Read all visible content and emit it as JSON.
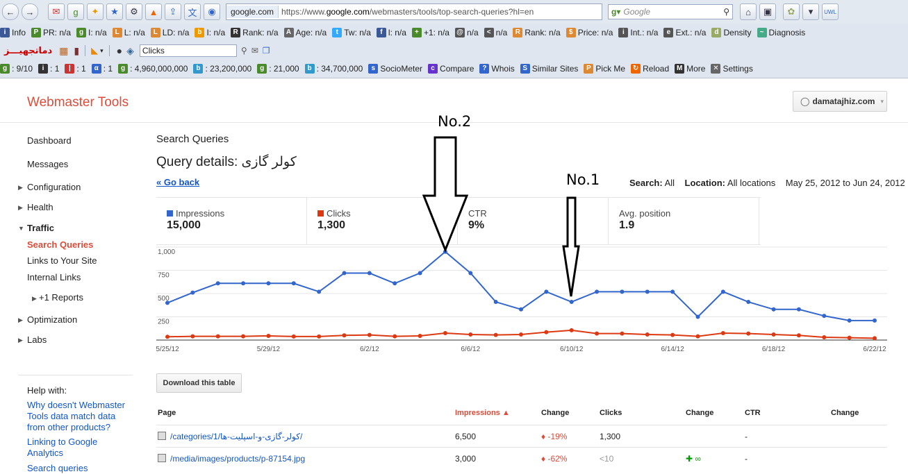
{
  "browser": {
    "url_host": "google.com",
    "url_prefix": "https://www.",
    "url_domain": "google.com",
    "url_path": "/webmasters/tools/top-search-queries?hl=en",
    "search_placeholder": "Google"
  },
  "toolbar1": [
    {
      "icon": "i",
      "label": "Info",
      "color": "#3b5998"
    },
    {
      "icon": "P",
      "label": "PR: n/a",
      "color": "#4a8a2a"
    },
    {
      "icon": "g",
      "label": "I: n/a",
      "color": "#4a8a2a"
    },
    {
      "icon": "L",
      "label": "L: n/a",
      "color": "#d83"
    },
    {
      "icon": "L",
      "label": "LD: n/a",
      "color": "#d83"
    },
    {
      "icon": "b",
      "label": "I: n/a",
      "color": "#e90"
    },
    {
      "icon": "R",
      "label": "Rank: n/a",
      "color": "#333"
    },
    {
      "icon": "A",
      "label": "Age: n/a",
      "color": "#666"
    },
    {
      "icon": "t",
      "label": "Tw: n/a",
      "color": "#3af"
    },
    {
      "icon": "f",
      "label": "l: n/a",
      "color": "#3b5998"
    },
    {
      "icon": "+",
      "label": "+1: n/a",
      "color": "#4a8a2a"
    },
    {
      "icon": "@",
      "label": "n/a",
      "color": "#555"
    },
    {
      "icon": "<",
      "label": "n/a",
      "color": "#555"
    },
    {
      "icon": "R",
      "label": "Rank: n/a",
      "color": "#d83"
    },
    {
      "icon": "$",
      "label": "Price: n/a",
      "color": "#d83"
    },
    {
      "icon": "i",
      "label": "Int.: n/a",
      "color": "#555"
    },
    {
      "icon": "e",
      "label": "Ext.: n/a",
      "color": "#555"
    },
    {
      "icon": "d",
      "label": "Density",
      "color": "#9a6"
    },
    {
      "icon": "~",
      "label": "Diagnosis",
      "color": "#4a8"
    }
  ],
  "toolbar2": {
    "brand": "دماتجهیـــز",
    "clicks_value": "Clicks"
  },
  "toolbar3": [
    {
      "icon": "g",
      "label": ": 9/10",
      "color": "#4a8a2a"
    },
    {
      "icon": "i",
      "label": ": 1",
      "color": "#333"
    },
    {
      "icon": "|",
      "label": ": 1",
      "color": "#c33"
    },
    {
      "icon": "α",
      "label": ": 1",
      "color": "#36c"
    },
    {
      "icon": "g",
      "label": ": 4,960,000,000",
      "color": "#4a8a2a"
    },
    {
      "icon": "b",
      "label": ": 23,200,000",
      "color": "#39c"
    },
    {
      "icon": "g",
      "label": ": 21,000",
      "color": "#4a8a2a"
    },
    {
      "icon": "b",
      "label": ": 34,700,000",
      "color": "#39c"
    },
    {
      "icon": "s",
      "label": "SocioMeter",
      "color": "#36c"
    },
    {
      "icon": "c",
      "label": "Compare",
      "color": "#63c"
    },
    {
      "icon": "?",
      "label": "Whois",
      "color": "#36c"
    },
    {
      "icon": "S",
      "label": "Similar Sites",
      "color": "#36c"
    },
    {
      "icon": "P",
      "label": "Pick Me",
      "color": "#d83"
    },
    {
      "icon": "↻",
      "label": "Reload",
      "color": "#e60"
    },
    {
      "icon": "M",
      "label": "More",
      "color": "#333"
    },
    {
      "icon": "✕",
      "label": "Settings",
      "color": "#666"
    }
  ],
  "header": {
    "product": "Webmaster Tools",
    "site": "damatajhiz.com"
  },
  "sidebar": {
    "dashboard": "Dashboard",
    "messages": "Messages",
    "configuration": "Configuration",
    "health": "Health",
    "traffic": "Traffic",
    "search_queries": "Search Queries",
    "links": "Links to Your Site",
    "internal": "Internal Links",
    "plus1": "+1 Reports",
    "optimization": "Optimization",
    "labs": "Labs"
  },
  "help": {
    "title": "Help with:",
    "link1": "Why doesn't Webmaster Tools data match data from other products?",
    "link2": "Linking to Google Analytics",
    "link3": "Search queries"
  },
  "main": {
    "crumb": "Search Queries",
    "title": "Query details: کولر گازی",
    "go_back": "« Go back",
    "search_label": "Search:",
    "search_value": "All",
    "location_label": "Location:",
    "location_value": "All locations",
    "date_range": "May 25, 2012 to Jun 24, 2012"
  },
  "metrics": [
    {
      "label": "Impressions",
      "value": "15,000",
      "color": "#3366cc"
    },
    {
      "label": "Clicks",
      "value": "1,300",
      "color": "#dc3912"
    },
    {
      "label": "CTR",
      "value": "9%",
      "color": ""
    },
    {
      "label": "Avg. position",
      "value": "1.9",
      "color": ""
    }
  ],
  "annotations": {
    "a1": "No.1",
    "a2": "No.2"
  },
  "chart_data": {
    "type": "line",
    "x": [
      "5/25/12",
      "5/26/12",
      "5/27/12",
      "5/28/12",
      "5/29/12",
      "5/30/12",
      "5/31/12",
      "6/1/12",
      "6/2/12",
      "6/3/12",
      "6/4/12",
      "6/5/12",
      "6/6/12",
      "6/7/12",
      "6/8/12",
      "6/9/12",
      "6/10/12",
      "6/11/12",
      "6/12/12",
      "6/13/12",
      "6/14/12",
      "6/15/12",
      "6/16/12",
      "6/17/12",
      "6/18/12",
      "6/19/12",
      "6/20/12",
      "6/21/12",
      "6/22/12"
    ],
    "xticks": [
      "5/25/12",
      "5/29/12",
      "6/2/12",
      "6/6/12",
      "6/10/12",
      "6/14/12",
      "6/18/12",
      "6/22/12"
    ],
    "yticks": [
      "1,000",
      "750",
      "500",
      "250"
    ],
    "ylim": [
      0,
      1000
    ],
    "series": [
      {
        "name": "Impressions",
        "color": "#3366cc",
        "values": [
          400,
          510,
          610,
          610,
          610,
          610,
          520,
          720,
          720,
          610,
          720,
          950,
          720,
          410,
          330,
          520,
          410,
          520,
          520,
          520,
          520,
          250,
          520,
          410,
          330,
          330,
          260,
          210,
          210
        ]
      },
      {
        "name": "Clicks",
        "color": "#dc3912",
        "values": [
          35,
          40,
          40,
          40,
          45,
          38,
          38,
          50,
          55,
          40,
          45,
          75,
          60,
          55,
          60,
          85,
          105,
          70,
          70,
          60,
          55,
          40,
          75,
          70,
          60,
          50,
          30,
          25,
          20
        ]
      }
    ],
    "grid": true,
    "legend": "none"
  },
  "table": {
    "download": "Download this table",
    "headers": {
      "page": "Page",
      "impressions": "Impressions ▲",
      "change1": "Change",
      "clicks": "Clicks",
      "change2": "Change",
      "ctr": "CTR",
      "change3": "Change"
    },
    "rows": [
      {
        "page": "/categories/1/کولر-گازی-و-اسپلیت-ها/",
        "impressions": "6,500",
        "change": "♦ -19%",
        "clicks": "1,300",
        "change2": "",
        "ctr": "-"
      },
      {
        "page": "/media/images/products/p-87154.jpg",
        "impressions": "3,000",
        "change": "♦ -62%",
        "clicks": "<10",
        "change2": "✚ ∞",
        "ctr": "-"
      }
    ]
  }
}
